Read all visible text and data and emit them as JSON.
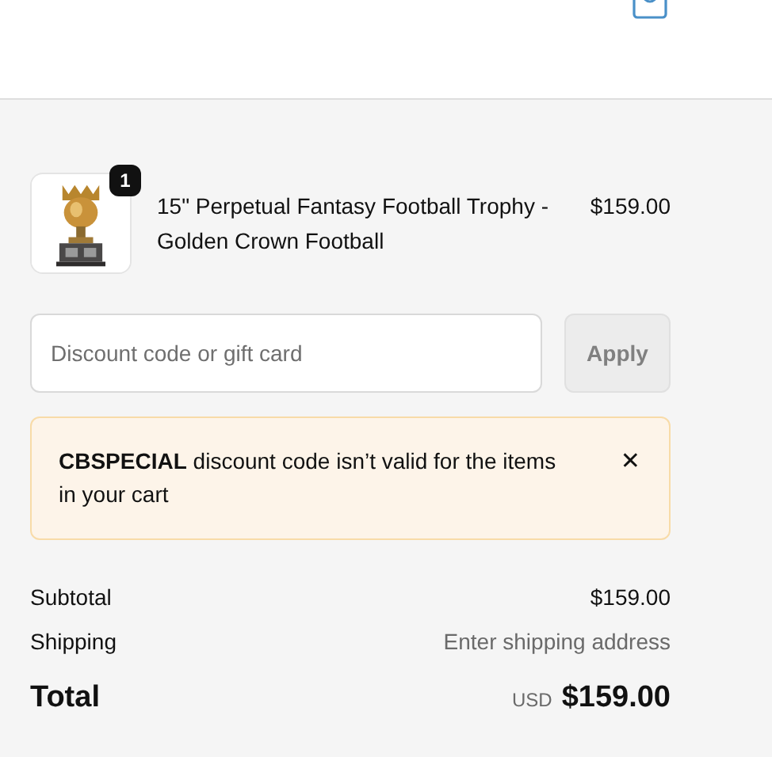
{
  "product": {
    "quantity": "1",
    "title": "15\" Perpetual Fantasy Football Trophy - Golden Crown Football",
    "price": "$159.00",
    "kind": "picture"
  },
  "discount": {
    "placeholder": "Discount code or gift card",
    "button": "Apply",
    "disabled": true
  },
  "alert": {
    "message": "**CBSPECIAL** discount code isn’t valid for the items in your cart",
    "close": "✕"
  },
  "summary": [
    {
      "label": "Subtotal",
      "value": "$159.00",
      "muted": false
    },
    {
      "label": "Shipping",
      "value": "Enter shipping address",
      "muted": true
    }
  ],
  "total": {
    "label": "Total",
    "currency": "USD",
    "amount": "$159.00"
  }
}
